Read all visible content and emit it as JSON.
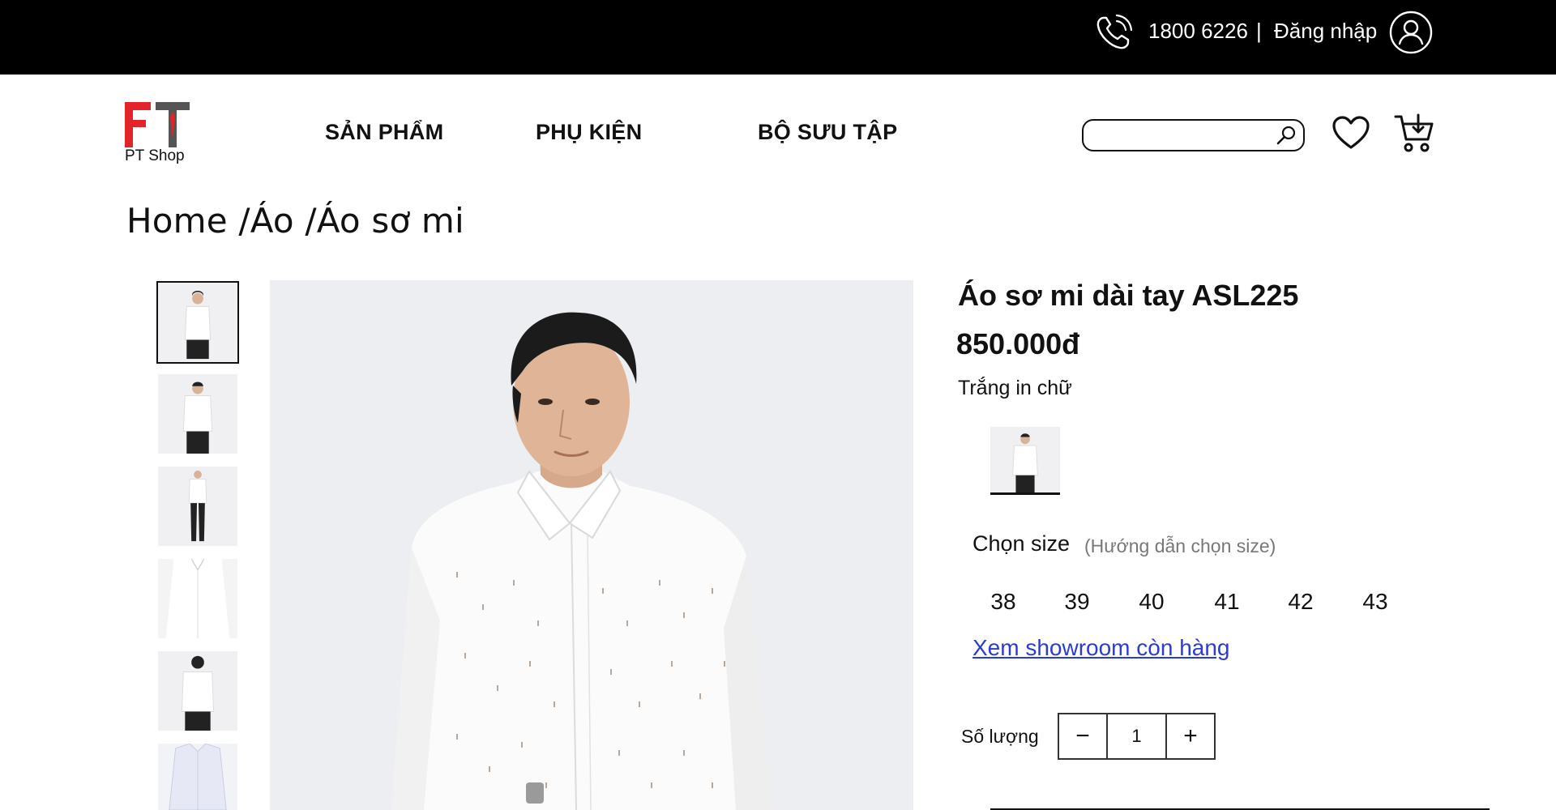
{
  "topbar": {
    "phone_icon": "phone-icon",
    "phone": "1800 6226",
    "separator": "|",
    "login": "Đăng nhập",
    "avatar_icon": "user-avatar-icon"
  },
  "header": {
    "logo_text": "PT Shop",
    "nav": [
      "SẢN PHẨM",
      "PHỤ KIỆN",
      "BỘ SƯU TẬP"
    ],
    "search": {
      "value": "",
      "placeholder": ""
    },
    "icons": [
      "search-icon",
      "heart-icon",
      "cart-icon"
    ]
  },
  "breadcrumb": [
    "Home ",
    " /Áo ",
    "/Áo sơ mi"
  ],
  "gallery": {
    "thumbnails": [
      "thumb-1",
      "thumb-2",
      "thumb-3",
      "thumb-4",
      "thumb-5",
      "thumb-6"
    ],
    "active_index": 0
  },
  "product": {
    "title": "Áo sơ mi dài tay ASL225",
    "price": "850.000đ",
    "color_name": "Trắng in chữ",
    "size_label": "Chọn size",
    "size_guide": "(Hướng dẫn chọn size)",
    "sizes": [
      "38",
      "39",
      "40",
      "41",
      "42",
      "43"
    ],
    "showroom_link": "Xem showroom còn hàng",
    "quantity_label": "Số lượng",
    "quantity": "1",
    "minus": "−",
    "plus": "+"
  },
  "colors": {
    "topbar_bg": "#000000",
    "logo_red": "#e2232a",
    "logo_gray": "#555555",
    "link": "#2b3bd6"
  }
}
